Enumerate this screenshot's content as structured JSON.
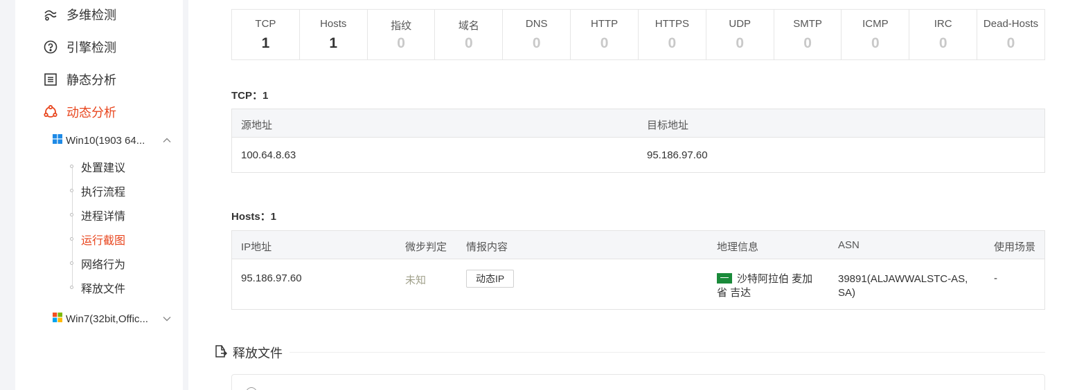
{
  "sidebar": {
    "nav": [
      {
        "label": "多维检测",
        "icon": "multi-detect-icon",
        "active": false
      },
      {
        "label": "引擎检测",
        "icon": "engine-detect-icon",
        "active": false
      },
      {
        "label": "静态分析",
        "icon": "static-analysis-icon",
        "active": false
      },
      {
        "label": "动态分析",
        "icon": "dynamic-analysis-icon",
        "active": true
      }
    ],
    "vms": [
      {
        "label": "Win10(1903 64...",
        "icon": "windows10-icon",
        "expanded": true
      },
      {
        "label": "Win7(32bit,Offic...",
        "icon": "windows7-icon",
        "expanded": false
      }
    ],
    "sub_items": [
      {
        "label": "处置建议",
        "active": false
      },
      {
        "label": "执行流程",
        "active": false
      },
      {
        "label": "进程详情",
        "active": false
      },
      {
        "label": "运行截图",
        "active": true
      },
      {
        "label": "网络行为",
        "active": false
      },
      {
        "label": "释放文件",
        "active": false
      }
    ]
  },
  "stats": [
    {
      "label": "TCP",
      "value": "1"
    },
    {
      "label": "Hosts",
      "value": "1"
    },
    {
      "label": "指纹",
      "value": "0"
    },
    {
      "label": "域名",
      "value": "0"
    },
    {
      "label": "DNS",
      "value": "0"
    },
    {
      "label": "HTTP",
      "value": "0"
    },
    {
      "label": "HTTPS",
      "value": "0"
    },
    {
      "label": "UDP",
      "value": "0"
    },
    {
      "label": "SMTP",
      "value": "0"
    },
    {
      "label": "ICMP",
      "value": "0"
    },
    {
      "label": "IRC",
      "value": "0"
    },
    {
      "label": "Dead-Hosts",
      "value": "0"
    }
  ],
  "tcp": {
    "title": "TCP：1",
    "headers": {
      "src": "源地址",
      "dst": "目标地址"
    },
    "rows": [
      {
        "src": "100.64.8.63",
        "dst": "95.186.97.60"
      }
    ]
  },
  "hosts": {
    "title": "Hosts：1",
    "headers": {
      "ip": "IP地址",
      "verdict": "微步判定",
      "intel": "情报内容",
      "geo": "地理信息",
      "asn": "ASN",
      "scene": "使用场景"
    },
    "rows": [
      {
        "ip": "95.186.97.60",
        "verdict": "未知",
        "intel": "动态IP",
        "geo_line1": "沙特阿拉伯 麦加",
        "geo_line2": "省 吉达",
        "asn_line1": "39891(ALJAWWALSTC-AS,",
        "asn_line2": "SA)",
        "scene": "-"
      }
    ]
  },
  "released_files": {
    "title": "释放文件"
  },
  "colors": {
    "accent": "#e8461e",
    "zero": "#c9c9c9",
    "flag": "#1a8a3a"
  }
}
